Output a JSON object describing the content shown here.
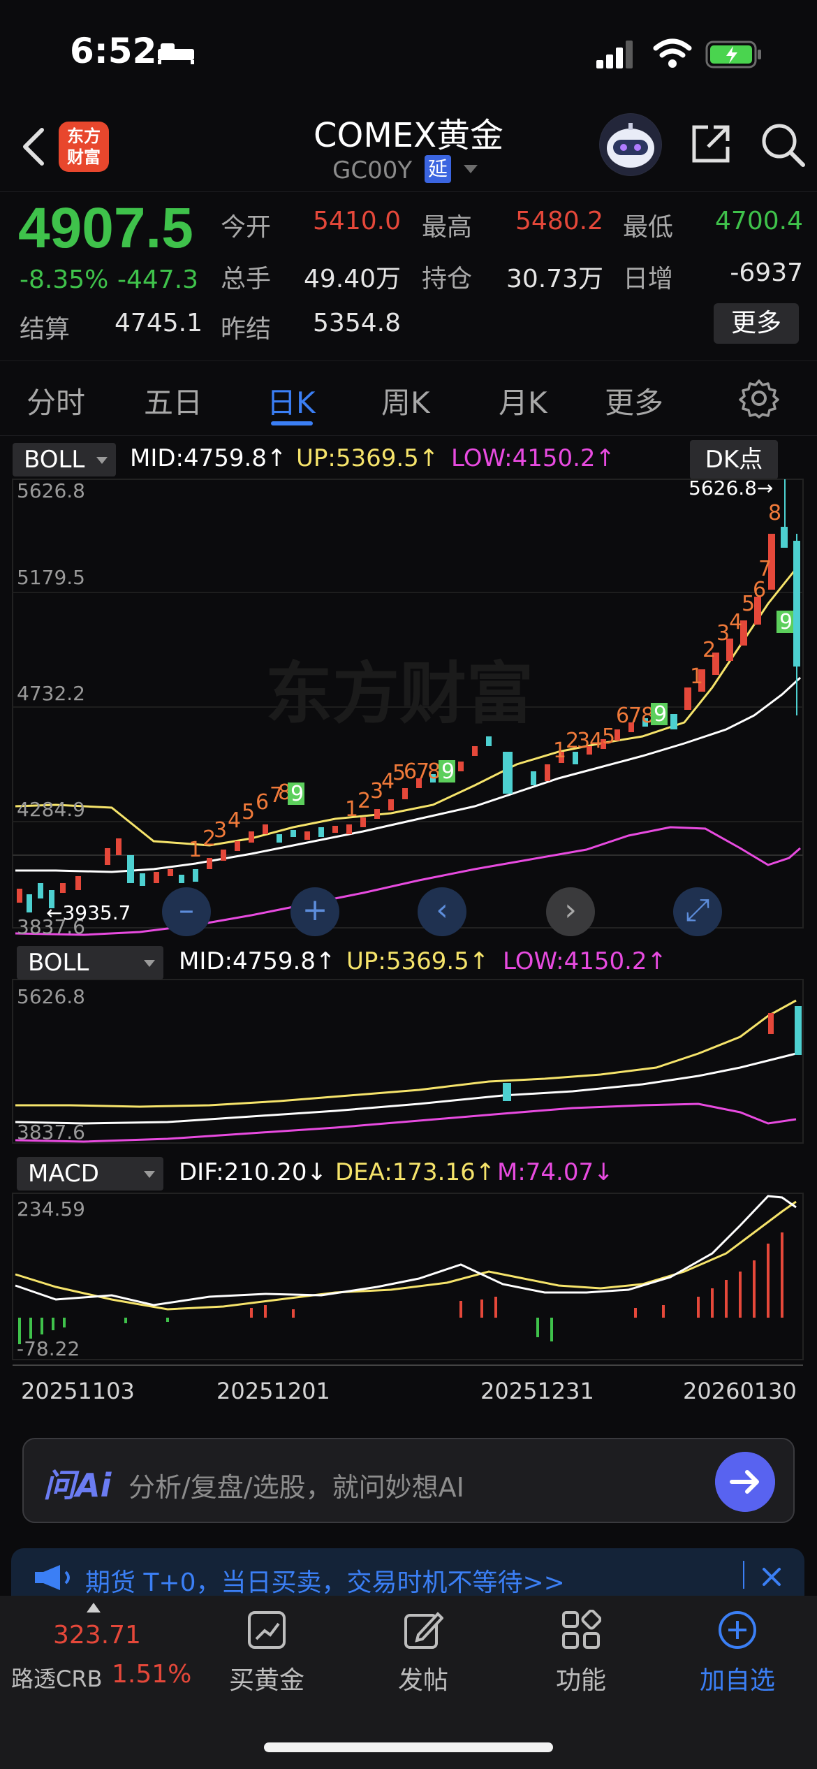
{
  "status_bar": {
    "time": "6:52"
  },
  "header": {
    "title": "COMEX黄金",
    "code": "GC00Y",
    "delay_badge": "延",
    "logo_text_1": "东方",
    "logo_text_2": "财富"
  },
  "quote": {
    "price": "4907.5",
    "change_pct": "-8.35%",
    "change_abs": "-447.3",
    "fields": [
      {
        "label": "今开",
        "value": "5410.0",
        "color": "#e5483a"
      },
      {
        "label": "最高",
        "value": "5480.2",
        "color": "#e5483a"
      },
      {
        "label": "最低",
        "value": "4700.4",
        "color": "#3fc24b"
      },
      {
        "label": "总手",
        "value": "49.40万",
        "color": "#e6e6e6"
      },
      {
        "label": "持仓",
        "value": "30.73万",
        "color": "#e6e6e6"
      },
      {
        "label": "日增",
        "value": "-6937",
        "color": "#e6e6e6"
      },
      {
        "label": "结算",
        "value": "4745.1",
        "color": "#e6e6e6"
      },
      {
        "label": "昨结",
        "value": "5354.8",
        "color": "#e6e6e6"
      }
    ],
    "more_label": "更多"
  },
  "tabs": [
    "分时",
    "五日",
    "日K",
    "周K",
    "月K",
    "更多"
  ],
  "active_tab": 2,
  "chart": {
    "main_indicator": "BOLL",
    "mid": "MID:4759.8",
    "up": "UP:5369.5",
    "low": "LOW:4150.2",
    "arrow_up": "↑",
    "arrow_down": "↓",
    "dk_label": "DK点",
    "y_ticks": [
      "5626.8",
      "5179.5",
      "4732.2",
      "4284.9",
      "3837.6"
    ],
    "max_marker": "5626.8→",
    "min_marker": "←3935.7",
    "watermark": "东方财富",
    "sub1_indicator": "BOLL",
    "sub1_y_top": "5626.8",
    "sub1_y_bottom": "3837.6",
    "sub2_indicator": "MACD",
    "dif": "DIF:210.20",
    "dea": "DEA:173.16",
    "m": "M:74.07",
    "macd_top": "234.59",
    "macd_bottom": "-78.22",
    "dates": [
      "20251103",
      "20251201",
      "20251231",
      "20260130"
    ],
    "controls": [
      "–",
      "+",
      "‹",
      "›",
      "⤢"
    ]
  },
  "ai": {
    "logo": "问Ai",
    "placeholder": "分析/复盘/选股，就问妙想AI"
  },
  "promo": {
    "text": "期货 T+0，当日买卖，交易时机不等待>>"
  },
  "bottom_nav": {
    "crb_value": "323.71",
    "crb_name": "路透CRB",
    "crb_pct": "1.51%",
    "items": [
      "买黄金",
      "发帖",
      "功能",
      "加自选"
    ]
  }
}
